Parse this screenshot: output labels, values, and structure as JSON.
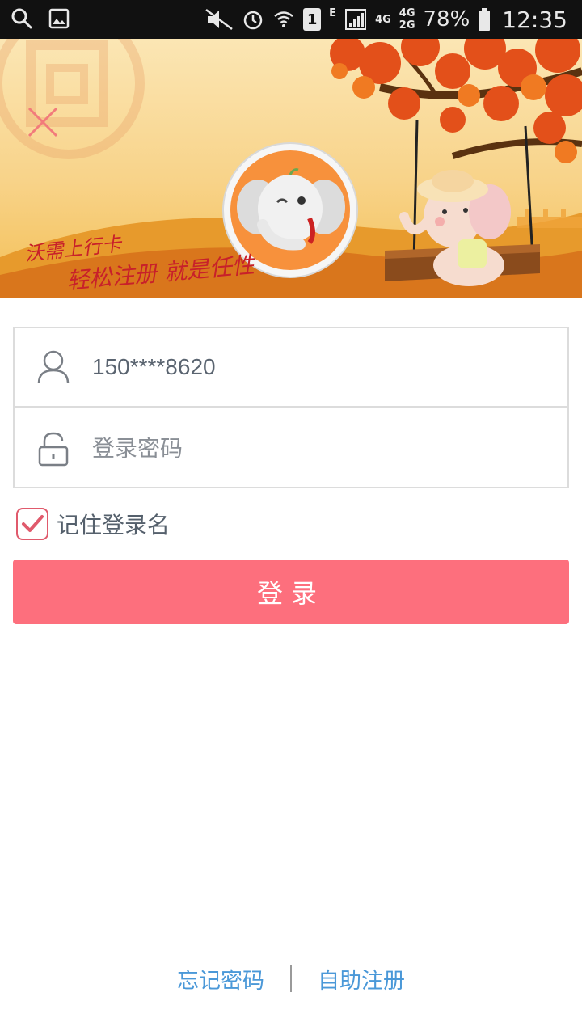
{
  "status_bar": {
    "network_4g": "4G",
    "network_4g2g_top": "4G",
    "network_4g2g_bottom": "2G",
    "network_e": "E",
    "sim_slot": "1",
    "battery": "78%",
    "time": "12:35",
    "icons": [
      "search-icon",
      "image-icon",
      "mute-icon",
      "alarm-icon",
      "wifi-icon",
      "sim-icon",
      "signal-icon",
      "battery-icon"
    ]
  },
  "banner": {
    "slogan_line1": "沃需上行卡",
    "slogan_line2": "轻松注册 就是任性",
    "icons": [
      "close-icon",
      "elephant-avatar",
      "bank-logo-watermark"
    ]
  },
  "form": {
    "username_value": "150****8620",
    "password_placeholder": "登录密码",
    "remember_label": "记住登录名",
    "remember_checked": true
  },
  "actions": {
    "login_label": "登录"
  },
  "footer": {
    "forgot_password": "忘记密码",
    "self_register": "自助注册"
  },
  "colors": {
    "accent": "#fd6f7d",
    "link": "#4a98d8",
    "checkbox": "#e05a6c"
  }
}
